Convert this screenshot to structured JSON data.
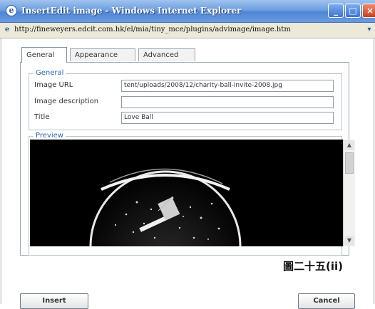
{
  "window": {
    "title": "InsertEdit image - Windows Internet Explorer",
    "app_icon": "ie-icon",
    "controls": {
      "minimize": "_",
      "maximize": "□",
      "close": "×"
    }
  },
  "address": {
    "url": "http://fineweyers.edcit.com.hk/el/mia/tiny_mce/plugins/advimage/image.htm"
  },
  "tabs": [
    {
      "label": "General",
      "active": true
    },
    {
      "label": "Appearance",
      "active": false
    },
    {
      "label": "Advanced",
      "active": false
    }
  ],
  "general": {
    "legend": "General",
    "image_url_label": "Image URL",
    "image_url_value": "tent/uploads/2008/12/charity-ball-invite-2008.jpg",
    "image_description_label": "Image description",
    "image_description_value": "",
    "title_label": "Title",
    "title_value": "Love Ball"
  },
  "preview": {
    "legend": "Preview"
  },
  "caption": "圖二十五(ii)",
  "buttons": {
    "insert": "Insert",
    "cancel": "Cancel"
  },
  "colors": {
    "titlebar": "#4f86d4",
    "legend": "#2d67b3",
    "close": "#c7401d"
  }
}
